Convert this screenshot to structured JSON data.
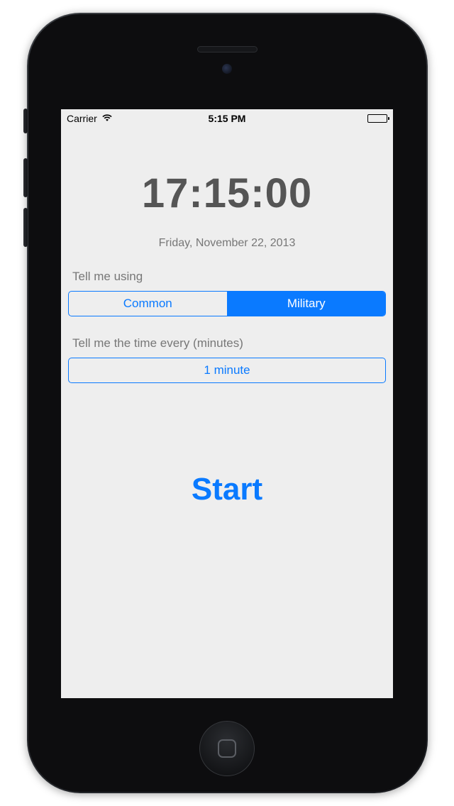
{
  "status": {
    "carrier": "Carrier",
    "time": "5:15 PM"
  },
  "clock": {
    "time": "17:15:00",
    "date": "Friday, November 22, 2013"
  },
  "format": {
    "label": "Tell me using",
    "option_common": "Common",
    "option_military": "Military",
    "selected": "Military"
  },
  "interval": {
    "label": "Tell me the time every (minutes)",
    "value": "1 minute"
  },
  "start": {
    "label": "Start"
  },
  "colors": {
    "accent": "#0a7aff",
    "bg": "#eeeeee"
  }
}
